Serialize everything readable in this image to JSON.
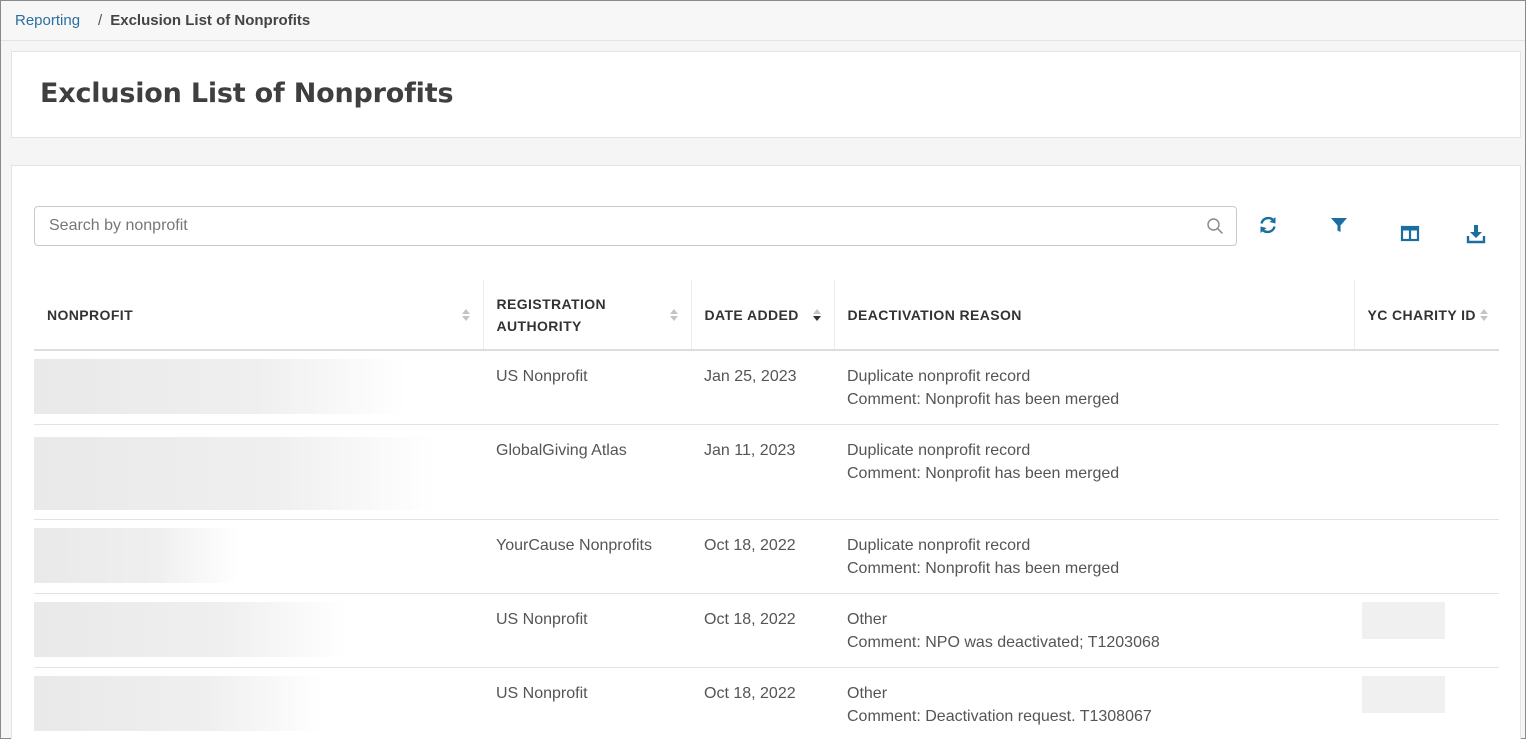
{
  "breadcrumb": {
    "parent": "Reporting",
    "separator": "/",
    "current": "Exclusion List of Nonprofits"
  },
  "page_title": "Exclusion List of Nonprofits",
  "search": {
    "placeholder": "Search by nonprofit",
    "value": ""
  },
  "toolbar": {
    "refresh_icon": "refresh-icon",
    "filter_icon": "filter-icon",
    "columns_icon": "columns-icon",
    "download_icon": "download-icon",
    "accent": "#1a6fa0"
  },
  "table": {
    "columns": {
      "nonprofit": "NONPROFIT",
      "authority_line1": "REGISTRATION",
      "authority_line2": "AUTHORITY",
      "date_added": "DATE ADDED",
      "reason": "DEACTIVATION REASON",
      "charity_id": "YC CHARITY ID"
    },
    "rows": [
      {
        "authority": "US Nonprofit",
        "date": "Jan 25, 2023",
        "reason": "Duplicate nonprofit record",
        "comment": "Comment: Nonprofit has been merged"
      },
      {
        "authority": "GlobalGiving Atlas",
        "date": "Jan 11, 2023",
        "reason": "Duplicate nonprofit record",
        "comment": "Comment: Nonprofit has been merged"
      },
      {
        "authority": "YourCause Nonprofits",
        "date": "Oct 18, 2022",
        "reason": "Duplicate nonprofit record",
        "comment": "Comment: Nonprofit has been merged"
      },
      {
        "authority": "US Nonprofit",
        "date": "Oct 18, 2022",
        "reason": "Other",
        "comment": "Comment: NPO was deactivated; T1203068"
      },
      {
        "authority": "US Nonprofit",
        "date": "Oct 18, 2022",
        "reason": "Other",
        "comment": "Comment: Deactivation request. T1308067"
      }
    ]
  }
}
